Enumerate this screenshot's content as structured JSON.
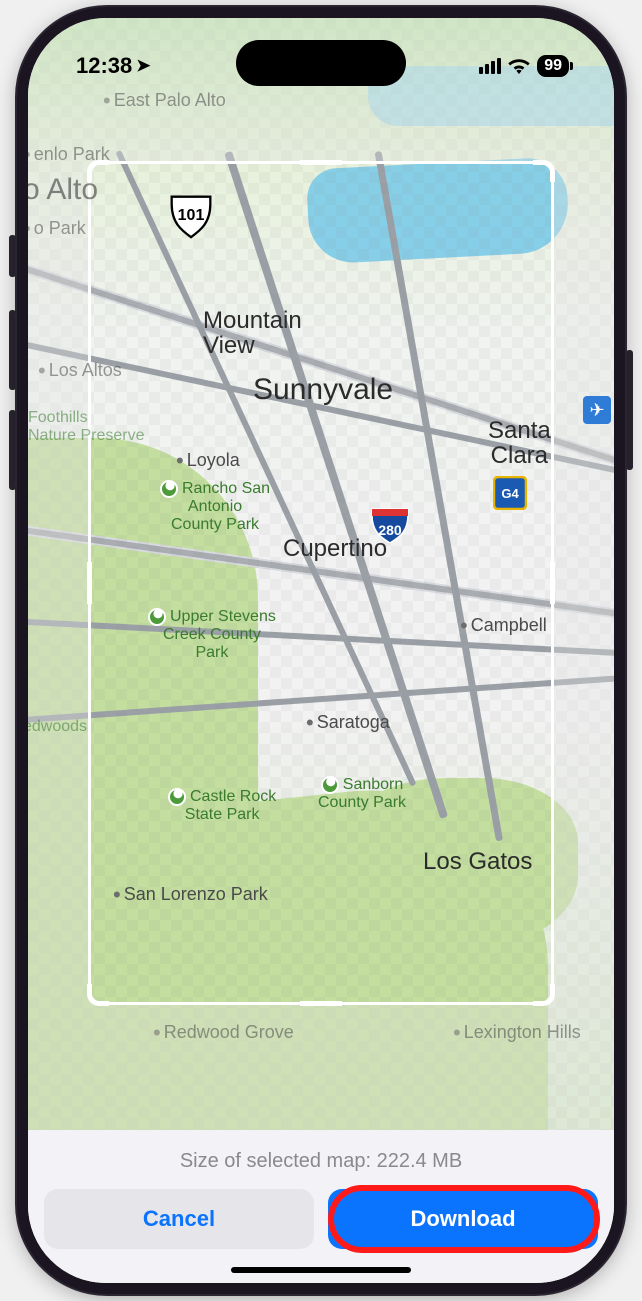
{
  "status": {
    "time": "12:38",
    "battery": "99"
  },
  "map": {
    "cities": {
      "sunnyvale": "Sunnyvale",
      "cupertino": "Cupertino",
      "mountain_view": "Mountain\nView",
      "santa_clara": "Santa\nClara",
      "los_gatos": "Los Gatos",
      "campbell": "Campbell",
      "saratoga": "Saratoga",
      "los_altos": "Los Altos",
      "loyola": "Loyola",
      "san_lorenzo_park": "San Lorenzo Park",
      "redwood_grove": "Redwood Grove",
      "lexington_hills": "Lexington Hills",
      "east_palo_alto": "East Palo Alto",
      "palo_alto": "o Alto",
      "menlo_park": "enlo Park",
      "o_park": "o Park",
      "foothills": "Foothills\nNature Preserve",
      "edwoods": "edwoods"
    },
    "parks": {
      "rancho": "Rancho San\nAntonio\nCounty Park",
      "upper_stevens": "Upper Stevens\nCreek County\nPark",
      "castle_rock": "Castle Rock\nState Park",
      "sanborn": "Sanborn\nCounty Park"
    },
    "shields": {
      "us101": "101",
      "i280": "280",
      "g4": "G4"
    }
  },
  "sheet": {
    "size_label": "Size of selected map: 222.4 MB",
    "cancel": "Cancel",
    "download": "Download"
  }
}
